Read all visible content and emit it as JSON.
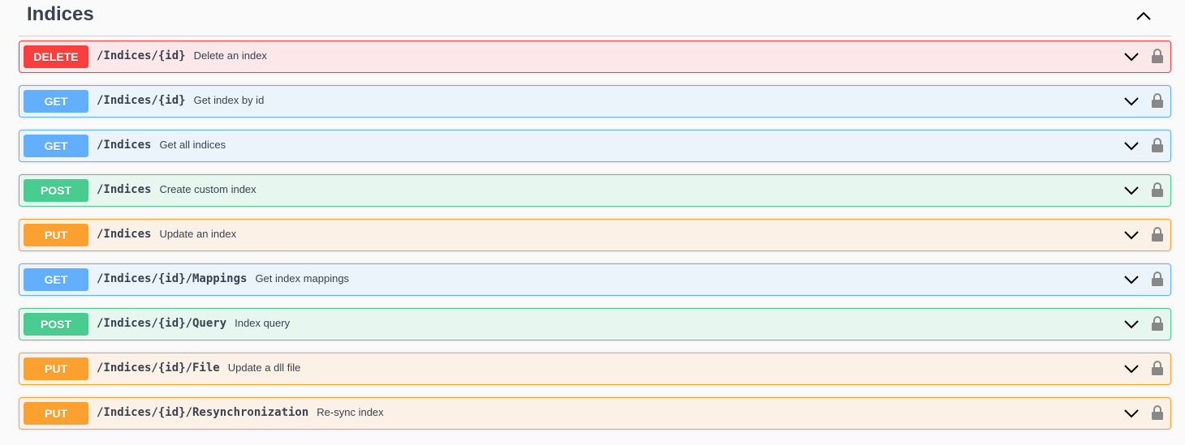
{
  "section": {
    "title": "Indices"
  },
  "icons": {
    "collapse": "chevron-up-icon",
    "expand": "chevron-down-icon",
    "auth": "lock-icon"
  },
  "colors": {
    "delete": "#f93e3e",
    "get": "#61affe",
    "post": "#49cc90",
    "put": "#fca130"
  },
  "operations": [
    {
      "method": "DELETE",
      "path": "/Indices/{id}",
      "summary": "Delete an index"
    },
    {
      "method": "GET",
      "path": "/Indices/{id}",
      "summary": "Get index by id"
    },
    {
      "method": "GET",
      "path": "/Indices",
      "summary": "Get all indices"
    },
    {
      "method": "POST",
      "path": "/Indices",
      "summary": "Create custom index"
    },
    {
      "method": "PUT",
      "path": "/Indices",
      "summary": "Update an index"
    },
    {
      "method": "GET",
      "path": "/Indices/{id}/Mappings",
      "summary": "Get index mappings"
    },
    {
      "method": "POST",
      "path": "/Indices/{id}/Query",
      "summary": "Index query"
    },
    {
      "method": "PUT",
      "path": "/Indices/{id}/File",
      "summary": "Update a dll file"
    },
    {
      "method": "PUT",
      "path": "/Indices/{id}/Resynchronization",
      "summary": "Re-sync index"
    }
  ]
}
